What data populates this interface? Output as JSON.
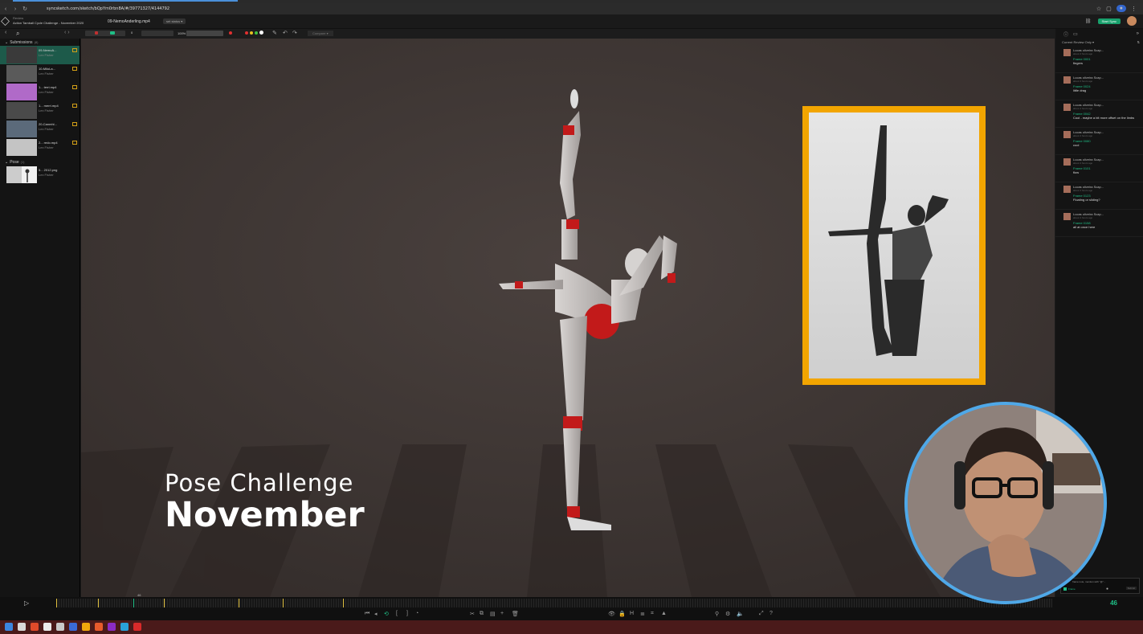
{
  "browser": {
    "url": "syncsketch.com/sketch/bQpYm0rbn8A/#/39771327/4144792"
  },
  "header": {
    "review_label": "Review",
    "project_title": "Action Tamball Cycle Challenge - November 2020",
    "filename": "09-NemoAnderling.mp4",
    "set_status": "set status",
    "start_sync": "Start Sync"
  },
  "toolbar": {
    "frame_value": "0",
    "zoom": "100%",
    "compare": "Compare",
    "colors": [
      "#e03030",
      "#e8c020",
      "#40c040",
      "#ffffff"
    ]
  },
  "left_panel": {
    "submissions": {
      "label": "Submissions",
      "count": "(8)"
    },
    "items": [
      {
        "title": "09-NemoA...",
        "author": "Lex Fisher",
        "selected": true
      },
      {
        "title": "10-MiloLa...",
        "author": "Lex Fisher",
        "selected": false
      },
      {
        "title": "1... terri.mp4",
        "author": "Lex Fisher",
        "selected": false
      },
      {
        "title": "1... merri.mp4",
        "author": "Lex Fisher",
        "selected": false
      },
      {
        "title": "20-Canmhl...",
        "author": "Lex Fisher",
        "selected": false
      },
      {
        "title": "2... redo.mp4",
        "author": "Lex Fisher",
        "selected": false
      }
    ],
    "pose": {
      "label": "Pose",
      "count": "(1)"
    },
    "pose_items": [
      {
        "title": "5... 2012.png",
        "author": "Lex Fisher"
      }
    ]
  },
  "viewer": {
    "overlay_line1": "Pose Challenge",
    "overlay_line2": "November"
  },
  "right_panel": {
    "filter_label": "Current Review Only",
    "comments": [
      {
        "name": "Lucas oliveira Scap...",
        "time": "about 4 hours ago",
        "frame": "Frame 0001",
        "text": "fingers"
      },
      {
        "name": "Lucas oliveira Scap...",
        "time": "about 4 hours ago",
        "frame": "Frame 0024",
        "text": "little drag"
      },
      {
        "name": "Lucas oliveira Scap...",
        "time": "about 4 hours ago",
        "frame": "Frame 0042",
        "text": "Cool - maybe a bit more offset on the limbs"
      },
      {
        "name": "Lucas oliveira Scap...",
        "time": "about 4 hours ago",
        "frame": "Frame 0080",
        "text": "cool"
      },
      {
        "name": "Lucas oliveira Scap...",
        "time": "about 4 hours ago",
        "frame": "Frame 0101",
        "text": "flow"
      },
      {
        "name": "Lucas oliveira Scap...",
        "time": "about 4 hours ago",
        "frame": "Frame 0123",
        "text": "Floating or sliding?"
      },
      {
        "name": "Lucas oliveira Scap...",
        "time": "about 4 hours ago",
        "frame": "Frame 0158",
        "text": "all at once here"
      }
    ],
    "note_placeholder": "frame note, mention with \"@\"...",
    "frame_toggle": "Frame",
    "submit": "Submit"
  },
  "timeline": {
    "current_frame": "46",
    "marker_label": "46"
  }
}
